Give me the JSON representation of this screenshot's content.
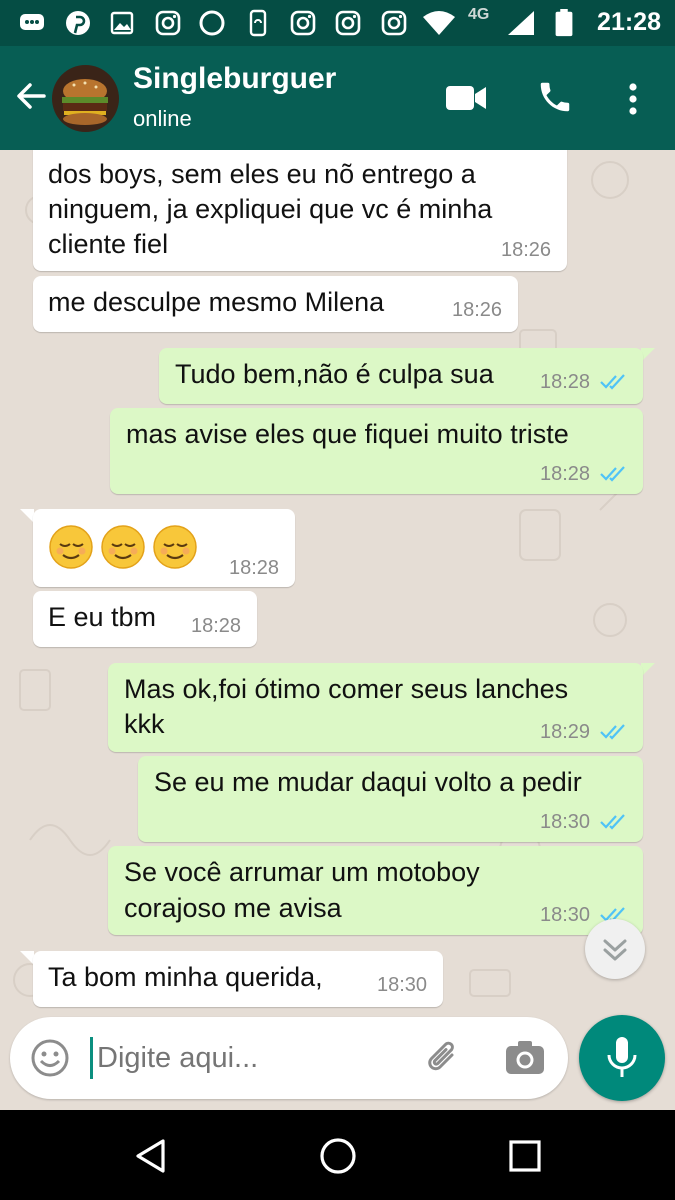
{
  "status_bar": {
    "time": "21:28",
    "network": "4G",
    "icons": [
      "message-icon",
      "pinterest-icon",
      "image-icon",
      "instagram-icon",
      "circle-icon",
      "phone-sync-icon",
      "instagram-icon",
      "instagram-icon",
      "instagram-icon",
      "wifi-icon",
      "signal-icon",
      "battery-icon"
    ]
  },
  "header": {
    "contact_name": "Singleburguer",
    "status": "online",
    "actions": [
      "video-call-icon",
      "voice-call-icon",
      "more-options-icon"
    ]
  },
  "messages": [
    {
      "dir": "in",
      "lines": [
        "dos boys, sem eles eu nõ entrego a",
        "ninguem, ja expliquei que vc é minha",
        "cliente fiel"
      ],
      "time": "18:26"
    },
    {
      "dir": "in",
      "lines": [
        "me desculpe mesmo Milena"
      ],
      "time": "18:26"
    },
    {
      "dir": "out",
      "lines": [
        "Tudo bem,não é culpa sua"
      ],
      "time": "18:28",
      "read": true
    },
    {
      "dir": "out",
      "lines": [
        "mas avise eles que fiquei muito triste"
      ],
      "time": "18:28",
      "read": true
    },
    {
      "dir": "in",
      "lines": [
        "😌😌😌"
      ],
      "time": "18:28"
    },
    {
      "dir": "in",
      "lines": [
        "E eu tbm"
      ],
      "time": "18:28"
    },
    {
      "dir": "out",
      "lines": [
        "Mas ok,foi ótimo comer seus lanches",
        "kkk"
      ],
      "time": "18:29",
      "read": true
    },
    {
      "dir": "out",
      "lines": [
        "Se eu me mudar daqui volto a pedir"
      ],
      "time": "18:30",
      "read": true
    },
    {
      "dir": "out",
      "lines": [
        "Se você arrumar um motoboy",
        "corajoso me avisa"
      ],
      "time": "18:30",
      "read": true
    },
    {
      "dir": "in",
      "lines": [
        "Ta bom minha querida,"
      ],
      "time": "18:30"
    }
  ],
  "composer": {
    "placeholder": "Digite aqui...",
    "icons": [
      "emoji-icon",
      "attach-icon",
      "camera-icon",
      "mic-icon"
    ]
  },
  "colors": {
    "header": "#075e54",
    "status_bar": "#054d44",
    "incoming": "#ffffff",
    "outgoing": "#dcf8c6",
    "read_ticks": "#4fc3f7",
    "accent": "#00897b"
  }
}
